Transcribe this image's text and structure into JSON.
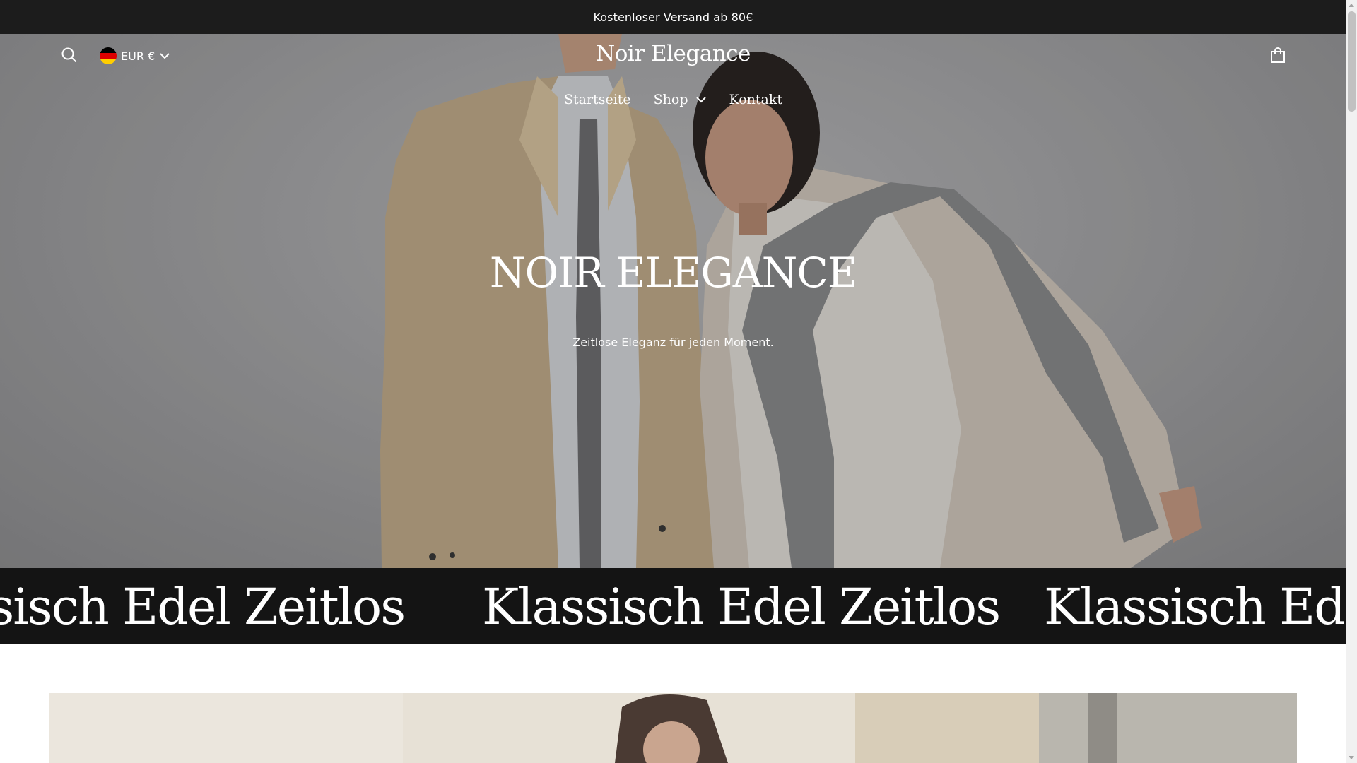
{
  "announcement": {
    "text": "Kostenloser Versand ab 80€"
  },
  "header": {
    "search_icon": "search-icon",
    "currency": {
      "label": "EUR €",
      "flag": "germany-flag-icon"
    },
    "logo": "Noir Elegance",
    "cart_icon": "shopping-bag-icon"
  },
  "nav": {
    "items": [
      {
        "label": "Startseite"
      },
      {
        "label": "Shop",
        "has_dropdown": true
      },
      {
        "label": "Kontakt"
      }
    ]
  },
  "hero": {
    "title": "NOIR ELEGANCE",
    "subtitle": "Zeitlose Eleganz für jeden Moment."
  },
  "marquee": {
    "items": [
      "Klassisch Edel Zeitlos",
      "Klassisch Edel Zeitlos",
      "Klassisch Edel Zeitlos"
    ]
  },
  "colors": {
    "announcement_bg": "#1c1c1c",
    "marquee_bg": "#141414",
    "text_light": "#ffffff"
  }
}
